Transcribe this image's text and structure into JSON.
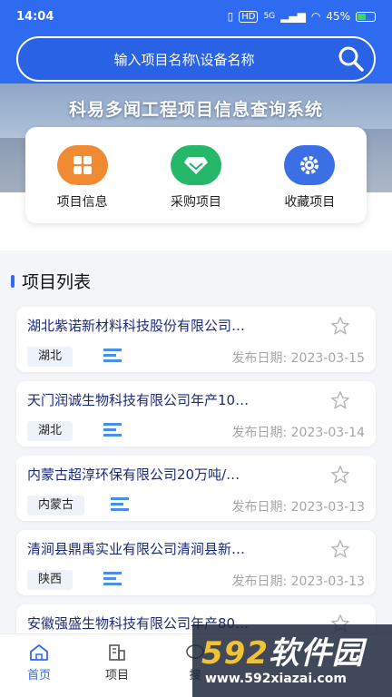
{
  "status": {
    "time": "14:04",
    "network": "5G",
    "hd": "HD",
    "battery": "45%"
  },
  "search": {
    "placeholder": "输入项目名称\\设备名称"
  },
  "banner": {
    "title": "科易多闻工程项目信息查询系统"
  },
  "quick_actions": [
    {
      "label": "项目信息",
      "icon": "grid-icon",
      "color": "#f08a33"
    },
    {
      "label": "采购项目",
      "icon": "diamond-icon",
      "color": "#26b86a"
    },
    {
      "label": "收藏项目",
      "icon": "gear-icon",
      "color": "#3b6fe6"
    }
  ],
  "section": {
    "title": "项目列表"
  },
  "projects": [
    {
      "title": "湖北紫诺新材料科技股份有限公司…",
      "region": "湖北",
      "date": "发布日期: 2023-03-15"
    },
    {
      "title": "天门润诚生物科技有限公司年产10…",
      "region": "湖北",
      "date": "发布日期: 2023-03-14"
    },
    {
      "title": "内蒙古超淳环保有限公司20万吨/…",
      "region": "内蒙古",
      "date": "发布日期: 2023-03-13"
    },
    {
      "title": "清涧县鼎禹实业有限公司清涧县新…",
      "region": "陕西",
      "date": "发布日期: 2023-03-13"
    },
    {
      "title": "安徽强盛生物科技有限公司年产80…",
      "region": "",
      "date": ""
    }
  ],
  "nav": [
    {
      "label": "首页",
      "icon": "home-icon",
      "active": true
    },
    {
      "label": "项目",
      "icon": "building-icon",
      "active": false
    },
    {
      "label": "搜",
      "icon": "chat-icon",
      "active": false
    }
  ],
  "watermark": {
    "logo_num": "592",
    "logo_text": "软件园",
    "url": "www.592xiazai.com"
  },
  "colors": {
    "primary": "#2f6bf0",
    "title_text": "#1c2a7a",
    "date_text": "#a6a6a6"
  }
}
